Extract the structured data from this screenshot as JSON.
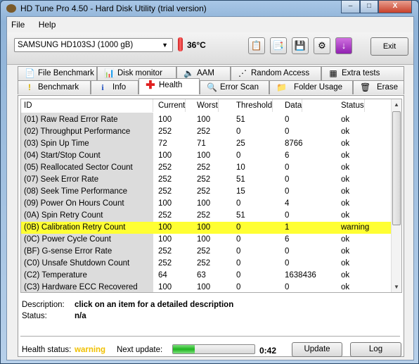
{
  "window": {
    "title": "HD Tune Pro 4.50 - Hard Disk Utility (trial version)",
    "minimize": "–",
    "maximize": "□",
    "close": "X"
  },
  "menu": [
    "File",
    "Help"
  ],
  "toolbar": {
    "drive": "SAMSUNG HD103SJ (1000 gB)",
    "temperature": "36°C",
    "exit": "Exit",
    "icons": [
      "copy-text-icon",
      "copy-screenshot-icon",
      "save-icon",
      "options-icon",
      "download-icon"
    ]
  },
  "tabs_row1": [
    "File Benchmark",
    "Disk monitor",
    "AAM",
    "Random Access",
    "Extra tests"
  ],
  "tabs_row2": [
    "Benchmark",
    "Info",
    "Health",
    "Error Scan",
    "Folder Usage",
    "Erase"
  ],
  "active_tab": "Health",
  "table": {
    "columns": [
      "ID",
      "Current",
      "Worst",
      "Threshold",
      "Data",
      "Status"
    ],
    "rows": [
      [
        "(01) Raw Read Error Rate",
        "100",
        "100",
        "51",
        "0",
        "ok"
      ],
      [
        "(02) Throughput Performance",
        "252",
        "252",
        "0",
        "0",
        "ok"
      ],
      [
        "(03) Spin Up Time",
        "72",
        "71",
        "25",
        "8766",
        "ok"
      ],
      [
        "(04) Start/Stop Count",
        "100",
        "100",
        "0",
        "6",
        "ok"
      ],
      [
        "(05) Reallocated Sector Count",
        "252",
        "252",
        "10",
        "0",
        "ok"
      ],
      [
        "(07) Seek Error Rate",
        "252",
        "252",
        "51",
        "0",
        "ok"
      ],
      [
        "(08) Seek Time Performance",
        "252",
        "252",
        "15",
        "0",
        "ok"
      ],
      [
        "(09) Power On Hours Count",
        "100",
        "100",
        "0",
        "4",
        "ok"
      ],
      [
        "(0A) Spin Retry Count",
        "252",
        "252",
        "51",
        "0",
        "ok"
      ],
      [
        "(0B) Calibration Retry Count",
        "100",
        "100",
        "0",
        "1",
        "warning"
      ],
      [
        "(0C) Power Cycle Count",
        "100",
        "100",
        "0",
        "6",
        "ok"
      ],
      [
        "(BF) G-sense Error Rate",
        "252",
        "252",
        "0",
        "0",
        "ok"
      ],
      [
        "(C0) Unsafe Shutdown Count",
        "252",
        "252",
        "0",
        "0",
        "ok"
      ],
      [
        "(C2) Temperature",
        "64",
        "63",
        "0",
        "1638436",
        "ok"
      ],
      [
        "(C3) Hardware ECC Recovered",
        "100",
        "100",
        "0",
        "0",
        "ok"
      ]
    ],
    "highlight_color": "#ffff33"
  },
  "details": {
    "description_label": "Description:",
    "description": "click on an item for a detailed description",
    "status_label": "Status:",
    "status": "n/a"
  },
  "footer": {
    "health_label": "Health status:",
    "health": "warning",
    "health_color": "#f0c000",
    "next_label": "Next update:",
    "progress_percent": 27,
    "countdown": "0:42",
    "update": "Update",
    "log": "Log"
  }
}
